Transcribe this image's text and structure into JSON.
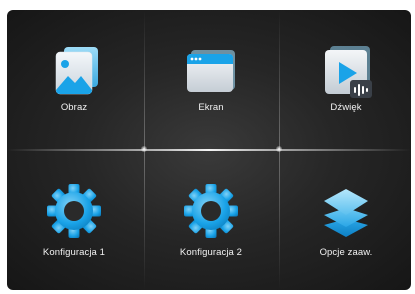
{
  "menu": {
    "tiles": [
      {
        "label": "Obraz",
        "icon": "picture-icon"
      },
      {
        "label": "Ekran",
        "icon": "screen-icon"
      },
      {
        "label": "Dźwięk",
        "icon": "sound-icon"
      },
      {
        "label": "Konfiguracja 1",
        "icon": "gear-icon"
      },
      {
        "label": "Konfiguracja 2",
        "icon": "gear-icon"
      },
      {
        "label": "Opcje zaaw.",
        "icon": "layers-icon"
      }
    ]
  },
  "colors": {
    "background": "#262626",
    "accent_blue": "#1aa3e8",
    "label_text": "#f2f2f2"
  }
}
